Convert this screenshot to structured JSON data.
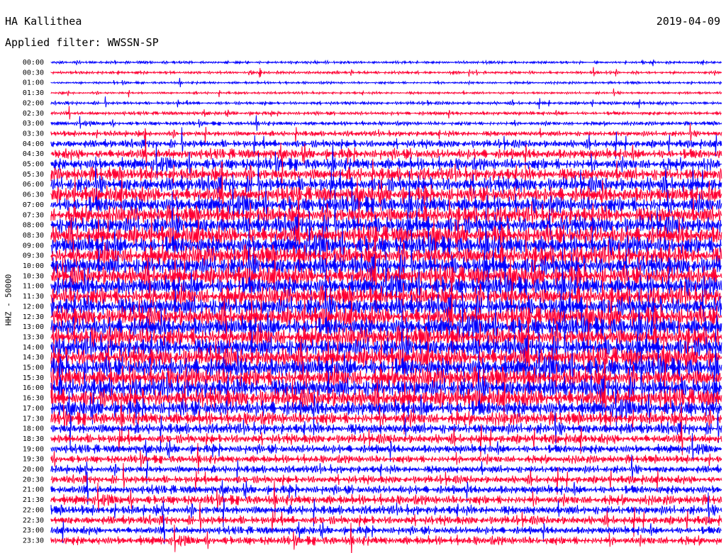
{
  "header": {
    "station": "HA Kallithea",
    "date": "2019-04-09",
    "filter": "Applied filter: WWSSN-SP"
  },
  "colors": {
    "trace_a": "#0000ff",
    "trace_b": "#ff0033",
    "background": "#ffffff"
  },
  "chart_data": {
    "type": "line",
    "title": "HA Kallithea",
    "subtitle": "Applied filter: WWSSN-SP",
    "date": "2019-04-09",
    "ylabel": "HHZ - 50000",
    "row_labels": [
      "00:00",
      "00:30",
      "01:00",
      "01:30",
      "02:00",
      "02:30",
      "03:00",
      "03:30",
      "04:00",
      "04:30",
      "05:00",
      "05:30",
      "06:00",
      "06:30",
      "07:00",
      "07:30",
      "08:00",
      "08:30",
      "09:00",
      "09:30",
      "10:00",
      "10:30",
      "11:00",
      "11:30",
      "12:00",
      "12:30",
      "13:00",
      "13:30",
      "14:00",
      "14:30",
      "15:00",
      "15:30",
      "16:00",
      "16:30",
      "17:00",
      "17:30",
      "18:00",
      "18:30",
      "19:00",
      "19:30",
      "20:00",
      "20:30",
      "21:00",
      "21:30",
      "22:00",
      "22:30",
      "23:00",
      "23:30"
    ],
    "row_colors": [
      "blue",
      "red"
    ],
    "relative_amplitude": [
      0.35,
      0.35,
      0.3,
      0.3,
      0.4,
      0.45,
      0.5,
      0.7,
      1.0,
      1.3,
      1.5,
      1.7,
      1.9,
      2.0,
      2.1,
      2.2,
      2.3,
      2.4,
      2.4,
      2.5,
      2.5,
      2.5,
      2.4,
      2.4,
      2.5,
      2.5,
      2.5,
      2.5,
      2.5,
      2.5,
      2.5,
      2.5,
      2.5,
      2.4,
      2.0,
      1.6,
      1.4,
      1.2,
      1.1,
      1.0,
      1.0,
      1.0,
      1.1,
      1.2,
      1.2,
      1.1,
      1.0,
      1.1
    ],
    "grid": false
  }
}
